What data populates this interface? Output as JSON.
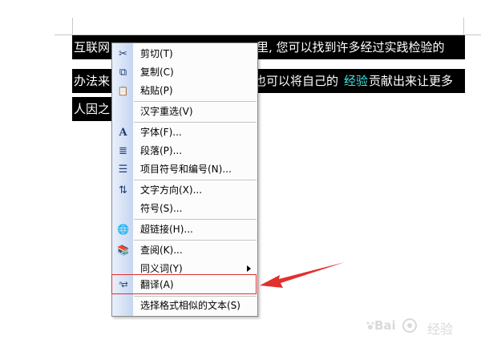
{
  "document": {
    "line1_left": "互联网",
    "line1_right": "里, 您可以找到许多经过实践检验的",
    "line2_left": "办法来",
    "line2_mid": "也可以将自己的",
    "line2_highlight": "经验",
    "line2_right": "贡献出来让更多",
    "line3": "人因之"
  },
  "context_menu": {
    "items": [
      {
        "icon": "cut-icon",
        "glyph": "✂",
        "label": "剪切(T)"
      },
      {
        "icon": "copy-icon",
        "glyph": "⧉",
        "label": "复制(C)"
      },
      {
        "icon": "paste-icon",
        "glyph": "📋",
        "label": "粘贴(P)"
      },
      {
        "icon": "",
        "glyph": "",
        "label": "汉字重选(V)"
      },
      {
        "icon": "font-icon",
        "glyph": "A",
        "label": "字体(F)..."
      },
      {
        "icon": "paragraph-icon",
        "glyph": "≣",
        "label": "段落(P)..."
      },
      {
        "icon": "bullets-icon",
        "glyph": "☰",
        "label": "项目符号和编号(N)..."
      },
      {
        "icon": "text-direction-icon",
        "glyph": "⇅",
        "label": "文字方向(X)..."
      },
      {
        "icon": "",
        "glyph": "",
        "label": "符号(S)..."
      },
      {
        "icon": "hyperlink-icon",
        "glyph": "🌐",
        "label": "超链接(H)..."
      },
      {
        "icon": "lookup-icon",
        "glyph": "📚",
        "label": "查阅(K)..."
      },
      {
        "icon": "",
        "glyph": "",
        "label": "同义词(Y)"
      },
      {
        "icon": "translate-icon",
        "glyph": "ᵃ⇄",
        "label": "翻译(A)"
      },
      {
        "icon": "",
        "glyph": "",
        "label": "选择格式相似的文本(S)"
      }
    ]
  },
  "watermark": {
    "text": "Bai",
    "sub": "经验"
  },
  "colors": {
    "selection": "#000000",
    "highlight_word": "#3fe0e0",
    "annotation": "#e03030"
  }
}
